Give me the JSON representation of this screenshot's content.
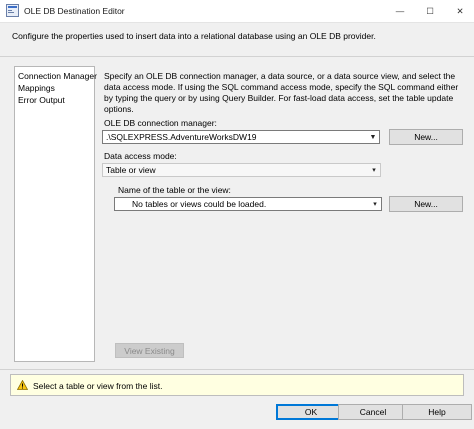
{
  "window": {
    "title": "OLE DB Destination Editor",
    "minimize": "—",
    "maximize": "☐",
    "close": "✕"
  },
  "description": "Configure the properties used to insert data into a relational database using an OLE DB provider.",
  "nav": {
    "items": [
      {
        "label": "Connection Manager"
      },
      {
        "label": "Mappings"
      },
      {
        "label": "Error Output"
      }
    ]
  },
  "instructions": "Specify an OLE DB connection manager, a data source, or a data source view, and select the data access mode. If using the SQL command access mode, specify the SQL command either by typing the query or by using Query Builder. For fast-load data access, set the table update options.",
  "connection": {
    "label": "OLE DB connection manager:",
    "value": ".\\SQLEXPRESS.AdventureWorksDW19",
    "new_button": "New..."
  },
  "access_mode": {
    "label": "Data access mode:",
    "value": "Table or view"
  },
  "table": {
    "label": "Name of the table or the view:",
    "value": "No tables or views could be loaded.",
    "new_button": "New..."
  },
  "view_existing": "View Existing",
  "status": {
    "message": "Select a table or view from the list."
  },
  "footer": {
    "ok": "OK",
    "cancel": "Cancel",
    "help": "Help"
  },
  "colors": {
    "accent": "#0078d7",
    "status_background": "#ffffe1",
    "warning": "#f7c512"
  }
}
